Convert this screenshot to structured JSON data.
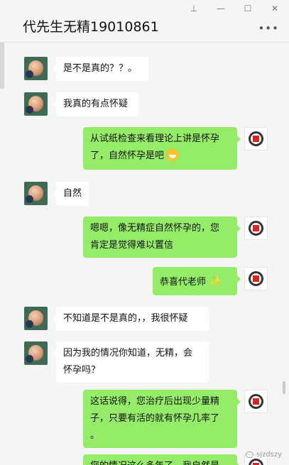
{
  "header": {
    "title": "代先生无精19010861",
    "pin_icon": "pin-icon",
    "minimize_icon": "minimize-icon",
    "maximize_icon": "maximize-icon",
    "close_icon": "close-icon",
    "more_icon": "more-icon"
  },
  "messages": [
    {
      "side": "left",
      "text": "是不是真的？？。"
    },
    {
      "side": "left",
      "text": "我真的有点怀疑"
    },
    {
      "side": "right",
      "line1": "从试纸检查来看理论上讲是怀孕",
      "line2": "了，自然怀孕是吧",
      "emoji": "grinning-face"
    },
    {
      "side": "left",
      "text": "自然"
    },
    {
      "side": "right",
      "line1": "嗯嗯，像无精症自然怀孕的，您",
      "line2": "肯定是觉得难以置信"
    },
    {
      "side": "right",
      "text": "恭喜代老师",
      "emoji": "sparkles"
    },
    {
      "side": "left",
      "text": "不知道是不是真的，，我很怀疑"
    },
    {
      "side": "left",
      "line1": "因为我的情况你知道，无精，会",
      "line2": "怀孕吗？"
    },
    {
      "side": "right",
      "line1": "这话说得，您治疗后出现少量精",
      "line2": "子，只要有活的就有怀孕几率了",
      "line3": "。"
    },
    {
      "side": "right",
      "line1": "您的情况这么多年了，我自然是"
    }
  ],
  "watermark": {
    "text": "sjzdszy"
  },
  "colors": {
    "self_bubble": "#95ec69",
    "other_bubble": "#ffffff",
    "background": "#f5f5f5"
  }
}
